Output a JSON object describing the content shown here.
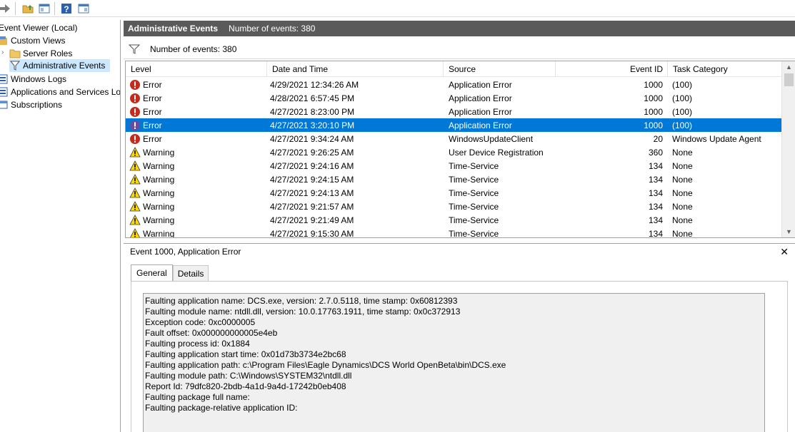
{
  "toolbar": {
    "buttons": [
      "forward-icon",
      "up-folder-icon",
      "show-hide-tree-icon",
      "help-icon",
      "show-hide-action-pane-icon"
    ]
  },
  "tree": {
    "items": [
      {
        "label": "Event Viewer (Local)",
        "icon": "event-viewer-icon"
      },
      {
        "label": "Custom Views",
        "icon": "custom-views-icon"
      },
      {
        "label": "Server Roles",
        "icon": "folder-icon"
      },
      {
        "label": "Administrative Events",
        "icon": "filter-icon"
      },
      {
        "label": "Windows Logs",
        "icon": "windows-logs-icon"
      },
      {
        "label": "Applications and Services Lo",
        "icon": "applications-logs-icon"
      },
      {
        "label": "Subscriptions",
        "icon": "subscriptions-icon"
      }
    ]
  },
  "header": {
    "title": "Administrative Events",
    "count": "Number of events: 380"
  },
  "filter": {
    "text": "Number of events: 380"
  },
  "table": {
    "columns": [
      "Level",
      "Date and Time",
      "Source",
      "Event ID",
      "Task Category"
    ],
    "rows": [
      {
        "level": "Error",
        "date": "4/29/2021 12:34:26 AM",
        "source": "Application Error",
        "event_id": "1000",
        "task": "(100)"
      },
      {
        "level": "Error",
        "date": "4/28/2021 6:57:45 PM",
        "source": "Application Error",
        "event_id": "1000",
        "task": "(100)"
      },
      {
        "level": "Error",
        "date": "4/27/2021 8:23:00 PM",
        "source": "Application Error",
        "event_id": "1000",
        "task": "(100)"
      },
      {
        "level": "Error",
        "date": "4/27/2021 3:20:10 PM",
        "source": "Application Error",
        "event_id": "1000",
        "task": "(100)"
      },
      {
        "level": "Error",
        "date": "4/27/2021 9:34:24 AM",
        "source": "WindowsUpdateClient",
        "event_id": "20",
        "task": "Windows Update Agent"
      },
      {
        "level": "Warning",
        "date": "4/27/2021 9:26:25 AM",
        "source": "User Device Registration",
        "event_id": "360",
        "task": "None"
      },
      {
        "level": "Warning",
        "date": "4/27/2021 9:24:16 AM",
        "source": "Time-Service",
        "event_id": "134",
        "task": "None"
      },
      {
        "level": "Warning",
        "date": "4/27/2021 9:24:15 AM",
        "source": "Time-Service",
        "event_id": "134",
        "task": "None"
      },
      {
        "level": "Warning",
        "date": "4/27/2021 9:24:13 AM",
        "source": "Time-Service",
        "event_id": "134",
        "task": "None"
      },
      {
        "level": "Warning",
        "date": "4/27/2021 9:21:57 AM",
        "source": "Time-Service",
        "event_id": "134",
        "task": "None"
      },
      {
        "level": "Warning",
        "date": "4/27/2021 9:21:49 AM",
        "source": "Time-Service",
        "event_id": "134",
        "task": "None"
      },
      {
        "level": "Warning",
        "date": "4/27/2021 9:15:30 AM",
        "source": "Time-Service",
        "event_id": "134",
        "task": "None"
      }
    ]
  },
  "detail": {
    "title": "Event 1000, Application Error",
    "tabs": [
      "General",
      "Details"
    ],
    "lines": [
      "Faulting application name: DCS.exe, version: 2.7.0.5118, time stamp: 0x60812393",
      "Faulting module name: ntdll.dll, version: 10.0.17763.1911, time stamp: 0x0c372913",
      "Exception code: 0xc0000005",
      "Fault offset: 0x000000000005e4eb",
      "Faulting process id: 0x1884",
      "Faulting application start time: 0x01d73b3734e2bc68",
      "Faulting application path: c:\\Program Files\\Eagle Dynamics\\DCS World OpenBeta\\bin\\DCS.exe",
      "Faulting module path: C:\\Windows\\SYSTEM32\\ntdll.dll",
      "Report Id: 79dfc820-2bdb-4a1d-9a4d-17242b0eb408",
      "Faulting package full name:",
      "Faulting package-relative application ID:"
    ]
  },
  "colors": {
    "selection": "#0078d7",
    "tree_selection": "#cce8ff",
    "header_bar": "#5a5a5a",
    "error": "#c42b1c",
    "warning": "#ffd800"
  }
}
